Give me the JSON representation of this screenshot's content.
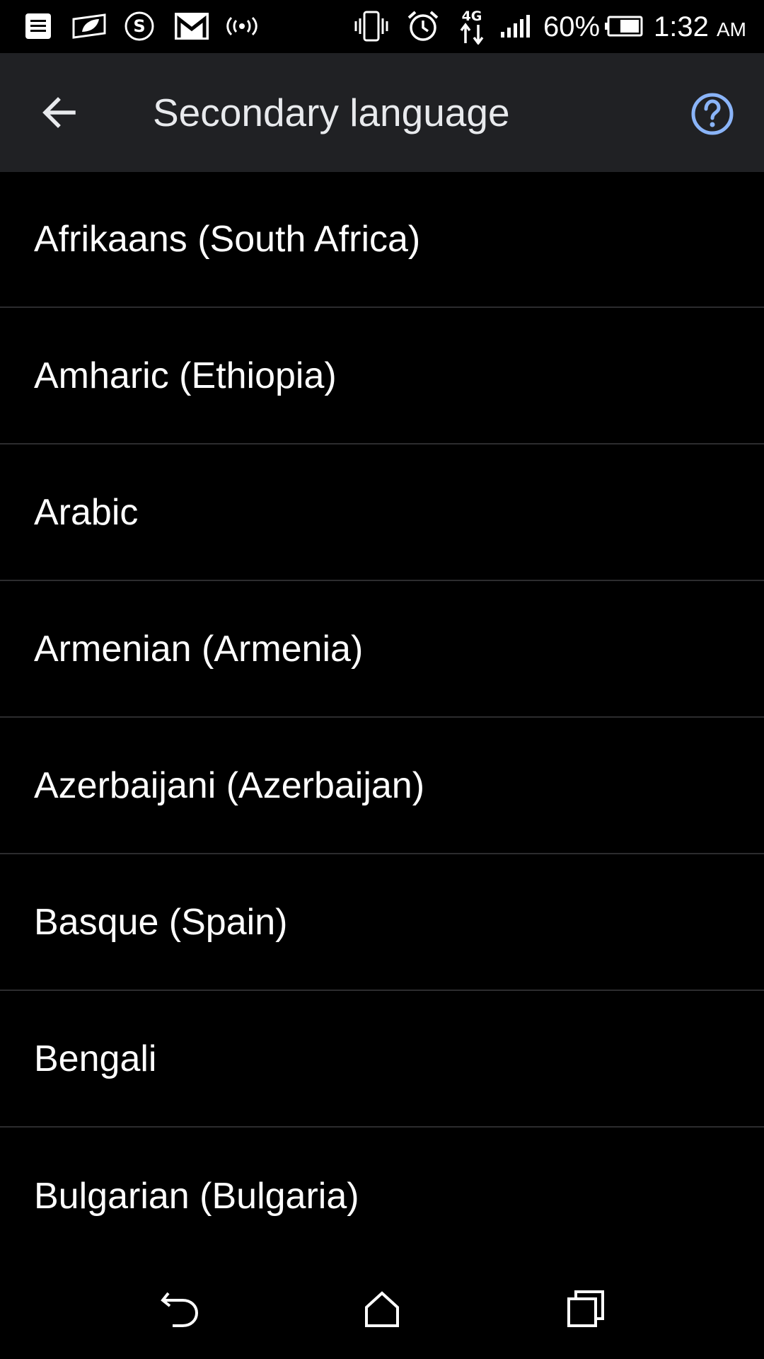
{
  "status_bar": {
    "icons_left": [
      "notes-icon",
      "leaf-card-icon",
      "s-coin-icon",
      "gmail-icon",
      "broadcast-icon"
    ],
    "icons_right": [
      "vibrate-icon",
      "alarm-icon",
      "4g-data-icon",
      "signal-icon"
    ],
    "network_label": "4G",
    "battery_percent": "60%",
    "time": "1:32",
    "ampm": "AM"
  },
  "app_bar": {
    "title": "Secondary language",
    "back_icon": "arrow-back-icon",
    "help_icon": "help-circle-icon",
    "accent_color": "#8ab4f8"
  },
  "languages": [
    "Afrikaans (South Africa)",
    "Amharic (Ethiopia)",
    "Arabic",
    "Armenian (Armenia)",
    "Azerbaijani (Azerbaijan)",
    "Basque (Spain)",
    "Bengali",
    "Bulgarian (Bulgaria)"
  ],
  "nav_bar": {
    "back_icon": "nav-back-icon",
    "home_icon": "home-icon",
    "recents_icon": "recents-icon"
  }
}
